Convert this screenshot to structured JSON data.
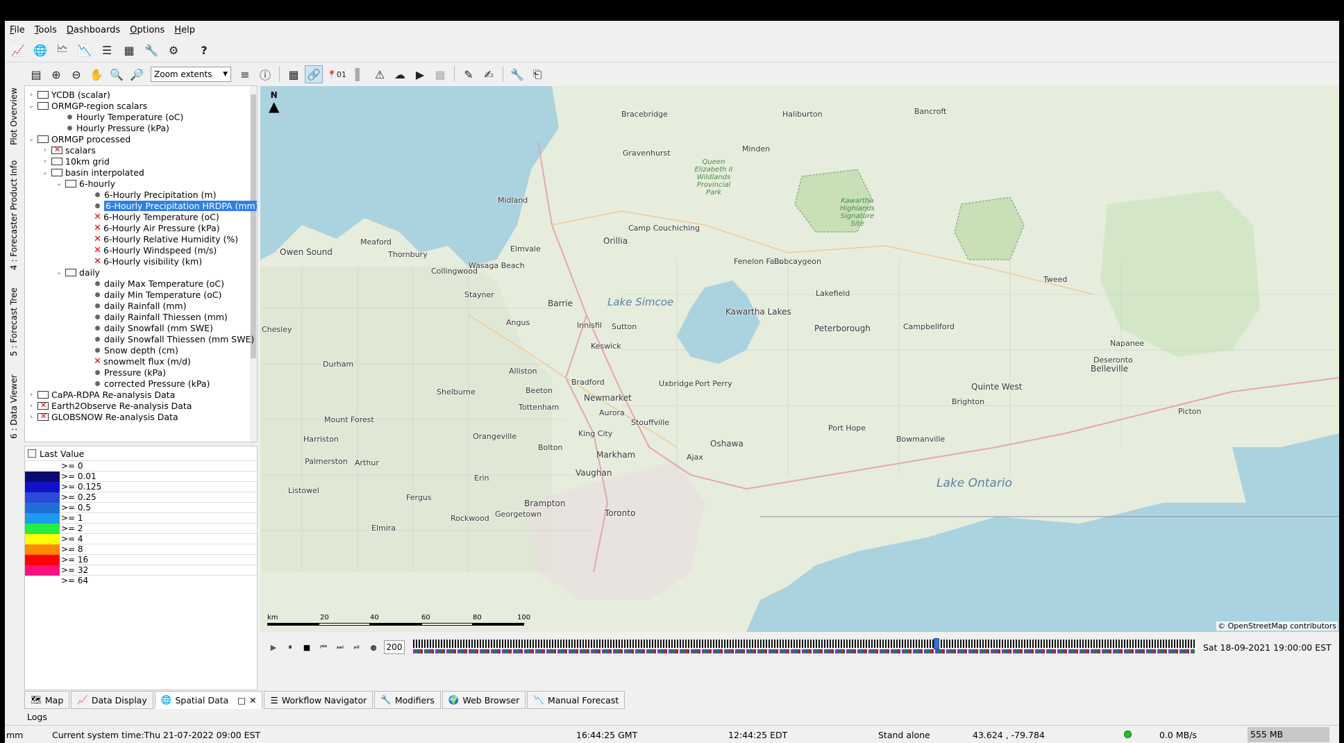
{
  "menu": [
    "File",
    "Tools",
    "Dashboards",
    "Options",
    "Help"
  ],
  "toolbar1": {
    "help_label": "?"
  },
  "vertical_tabs": [
    "Plot Overview",
    "4 : Forecaster Product Info",
    "5 : Forecast Tree",
    "6 : Data Viewer"
  ],
  "map_toolbar": {
    "zoom_select": "Zoom extents",
    "label_01": "01"
  },
  "tree": [
    {
      "label": "YCDB (scalar)",
      "type": "folder",
      "indent": 0,
      "expand": "›"
    },
    {
      "label": "ORMGP-region scalars",
      "type": "folder",
      "indent": 0,
      "expand": "⌄"
    },
    {
      "label": "Hourly Temperature (oC)",
      "type": "dot",
      "indent": 2
    },
    {
      "label": "Hourly Pressure (kPa)",
      "type": "dot",
      "indent": 2
    },
    {
      "label": "ORMGP processed",
      "type": "folder",
      "indent": 0,
      "expand": "⌄"
    },
    {
      "label": "scalars",
      "type": "folderx",
      "indent": 1,
      "expand": "›"
    },
    {
      "label": "10km grid",
      "type": "folder",
      "indent": 1,
      "expand": "›"
    },
    {
      "label": "basin interpolated",
      "type": "folder",
      "indent": 1,
      "expand": "⌄"
    },
    {
      "label": "6-hourly",
      "type": "folder",
      "indent": 2,
      "expand": "⌄"
    },
    {
      "label": "6-Hourly Precipitation (m)",
      "type": "dot",
      "indent": 4
    },
    {
      "label": "6-Hourly Precipitation HRDPA (mm)",
      "type": "dot",
      "indent": 4,
      "selected": true
    },
    {
      "label": "6-Hourly Temperature (oC)",
      "type": "x",
      "indent": 4
    },
    {
      "label": "6-Hourly Air Pressure (kPa)",
      "type": "x",
      "indent": 4
    },
    {
      "label": "6-Hourly Relative Humidity (%)",
      "type": "x",
      "indent": 4
    },
    {
      "label": "6-Hourly Windspeed (m/s)",
      "type": "x",
      "indent": 4
    },
    {
      "label": "6-Hourly visibility (km)",
      "type": "x",
      "indent": 4
    },
    {
      "label": "daily",
      "type": "folder",
      "indent": 2,
      "expand": "⌄"
    },
    {
      "label": "daily Max Temperature (oC)",
      "type": "dot",
      "indent": 4
    },
    {
      "label": "daily Min Temperature (oC)",
      "type": "dot",
      "indent": 4
    },
    {
      "label": "daily Rainfall (mm)",
      "type": "dot",
      "indent": 4
    },
    {
      "label": "daily Rainfall Thiessen (mm)",
      "type": "dot",
      "indent": 4
    },
    {
      "label": "daily Snowfall (mm SWE)",
      "type": "dot",
      "indent": 4
    },
    {
      "label": "daily Snowfall Thiessen (mm SWE)",
      "type": "dot",
      "indent": 4
    },
    {
      "label": "Snow depth (cm)",
      "type": "dot",
      "indent": 4
    },
    {
      "label": "snowmelt flux (m/d)",
      "type": "x",
      "indent": 4
    },
    {
      "label": "Pressure (kPa)",
      "type": "dot",
      "indent": 4
    },
    {
      "label": "corrected Pressure (kPa)",
      "type": "dot",
      "indent": 4
    },
    {
      "label": "CaPA-RDPA Re-analysis Data",
      "type": "folder",
      "indent": 0,
      "expand": "›"
    },
    {
      "label": "Earth2Observe Re-analysis Data",
      "type": "folderx",
      "indent": 0,
      "expand": "›"
    },
    {
      "label": "GLOBSNOW Re-analysis Data",
      "type": "folderx",
      "indent": 0,
      "expand": "›"
    }
  ],
  "legend": {
    "header": "Last Value",
    "rows": [
      {
        "label": ">= 0",
        "color": "#ffffff"
      },
      {
        "label": ">= 0.01",
        "color": "#0a0a6e"
      },
      {
        "label": ">= 0.125",
        "color": "#1010c8"
      },
      {
        "label": ">= 0.25",
        "color": "#2a4ad8"
      },
      {
        "label": ">= 0.5",
        "color": "#1f6fd6"
      },
      {
        "label": ">= 1",
        "color": "#1e9bf0"
      },
      {
        "label": ">= 2",
        "color": "#22ee44"
      },
      {
        "label": ">= 4",
        "color": "#ffff00"
      },
      {
        "label": ">= 8",
        "color": "#ff8800"
      },
      {
        "label": ">= 16",
        "color": "#ff0000"
      },
      {
        "label": ">= 32",
        "color": "#ff1080"
      },
      {
        "label": ">= 64",
        "color": "#ffffff"
      }
    ]
  },
  "map": {
    "north": "N",
    "attribution": "© OpenStreetMap contributors",
    "scale_labels": [
      "km",
      "20",
      "40",
      "60",
      "80",
      "100"
    ],
    "places": [
      {
        "name": "Bracebridge"
      },
      {
        "name": "Haliburton"
      },
      {
        "name": "Bancroft"
      },
      {
        "name": "Gravenhurst"
      },
      {
        "name": "Minden"
      },
      {
        "name": "Midland"
      },
      {
        "name": "Meaford"
      },
      {
        "name": "Owen Sound"
      },
      {
        "name": "Thornbury"
      },
      {
        "name": "Elmvale"
      },
      {
        "name": "Orillia"
      },
      {
        "name": "Wasaga Beach"
      },
      {
        "name": "Collingwood"
      },
      {
        "name": "Camp Couchiching"
      },
      {
        "name": "Fenelon Falls"
      },
      {
        "name": "Bobcaygeon"
      },
      {
        "name": "Tweed"
      },
      {
        "name": "Stayner"
      },
      {
        "name": "Barrie"
      },
      {
        "name": "Lakefield"
      },
      {
        "name": "Kawartha Lakes"
      },
      {
        "name": "Innisfil"
      },
      {
        "name": "Angus"
      },
      {
        "name": "Peterborough"
      },
      {
        "name": "Sutton"
      },
      {
        "name": "Campbellford"
      },
      {
        "name": "Chesley"
      },
      {
        "name": "Keswick"
      },
      {
        "name": "Napanee"
      },
      {
        "name": "Deseronto"
      },
      {
        "name": "Durham"
      },
      {
        "name": "Alliston"
      },
      {
        "name": "Belleville"
      },
      {
        "name": "Bradford"
      },
      {
        "name": "Uxbridge"
      },
      {
        "name": "Port Perry"
      },
      {
        "name": "Quinte West"
      },
      {
        "name": "Shelburne"
      },
      {
        "name": "Beeton"
      },
      {
        "name": "Newmarket"
      },
      {
        "name": "Brighton"
      },
      {
        "name": "Tottenham"
      },
      {
        "name": "Aurora"
      },
      {
        "name": "Stouffville"
      },
      {
        "name": "Mount Forest"
      },
      {
        "name": "Picton"
      },
      {
        "name": "Port Hope"
      },
      {
        "name": "King City"
      },
      {
        "name": "Orangeville"
      },
      {
        "name": "Harriston"
      },
      {
        "name": "Bowmanville"
      },
      {
        "name": "Oshawa"
      },
      {
        "name": "Bolton"
      },
      {
        "name": "Markham"
      },
      {
        "name": "Ajax"
      },
      {
        "name": "Palmerston"
      },
      {
        "name": "Arthur"
      },
      {
        "name": "Vaughan"
      },
      {
        "name": "Erin"
      },
      {
        "name": "Listowel"
      },
      {
        "name": "Fergus"
      },
      {
        "name": "Brampton"
      },
      {
        "name": "Toronto"
      },
      {
        "name": "Georgetown"
      },
      {
        "name": "Elmira"
      },
      {
        "name": "Rockwood"
      }
    ],
    "lakes": {
      "simcoe": "Lake Simcoe",
      "ontario": "Lake Ontario"
    },
    "parks": {
      "queen": "Queen Elizabeth II Wildlands Provincial Park",
      "kawartha": "Kawartha Highlands Signature Site"
    }
  },
  "timebar": {
    "speed": "200",
    "time": "Sat 18-09-2021 19:00:00 EST",
    "progress": 0.67
  },
  "bottom_tabs": [
    "Map",
    "Data Display",
    "Spatial Data",
    "Workflow Navigator",
    "Modifiers",
    "Web Browser",
    "Manual Forecast"
  ],
  "logs_label": "Logs",
  "status": {
    "unit": "mm",
    "system_time": "Current system time:Thu 21-07-2022 09:00 EST",
    "gmt": "16:44:25 GMT",
    "edt": "12:44:25 EDT",
    "mode": "Stand alone",
    "coords": "43.624 , -79.784",
    "rate": "0.0 MB/s",
    "memory": "555 MB"
  }
}
